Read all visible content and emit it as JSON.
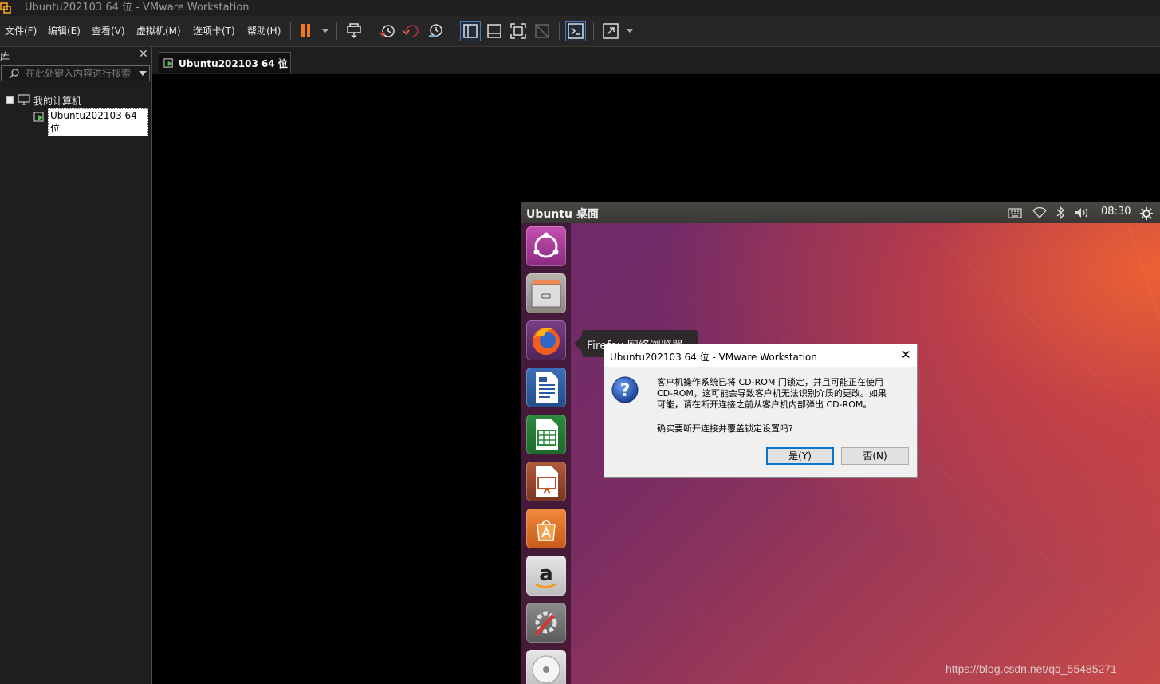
{
  "window": {
    "title": "Ubuntu202103 64 位 - VMware Workstation"
  },
  "menu": {
    "items": [
      {
        "label": "文件(F)"
      },
      {
        "label": "编辑(E)"
      },
      {
        "label": "查看(V)"
      },
      {
        "label": "虚拟机(M)"
      },
      {
        "label": "选项卡(T)"
      },
      {
        "label": "帮助(H)"
      }
    ]
  },
  "toolbar": {
    "icons": [
      "pause-icon",
      "send-ctrl-alt-del-icon",
      "snapshot-take-icon",
      "snapshot-revert-icon",
      "snapshot-manager-icon",
      "show-library-icon",
      "show-thumbnail-icon",
      "full-screen-icon",
      "unity-icon",
      "console-view-icon",
      "stretch-icon"
    ]
  },
  "library": {
    "title": "库",
    "close": "✕",
    "search_placeholder": "在此处键入内容进行搜索",
    "tree": {
      "root_label": "我的计算机",
      "vm_label": "Ubuntu202103 64 位"
    }
  },
  "tab": {
    "label": "Ubuntu202103 64 位",
    "close": "✕"
  },
  "guest": {
    "desktop_title": "Ubuntu 桌面",
    "clock": "08:30",
    "launcher_tooltip": "Firefox 网络浏览器",
    "launcher_icons": [
      "ubuntu-dash-icon",
      "files-icon",
      "firefox-icon",
      "writer-icon",
      "calc-icon",
      "impress-icon",
      "software-center-icon",
      "amazon-icon",
      "system-settings-icon",
      "dvd-icon"
    ]
  },
  "dialog": {
    "title": "Ubuntu202103 64 位 - VMware Workstation",
    "close": "✕",
    "message_line1": "客户机操作系统已将 CD-ROM 门锁定，并且可能正在使用",
    "message_line2": "CD-ROM，这可能会导致客户机无法识别介质的更改。如果",
    "message_line3": "可能，请在断开连接之前从客户机内部弹出 CD-ROM。",
    "question": "确实要断开连接并覆盖锁定设置吗?",
    "yes_label": "是(Y)",
    "no_label": "否(N)"
  },
  "watermark": "https://blog.csdn.net/qq_55485271"
}
